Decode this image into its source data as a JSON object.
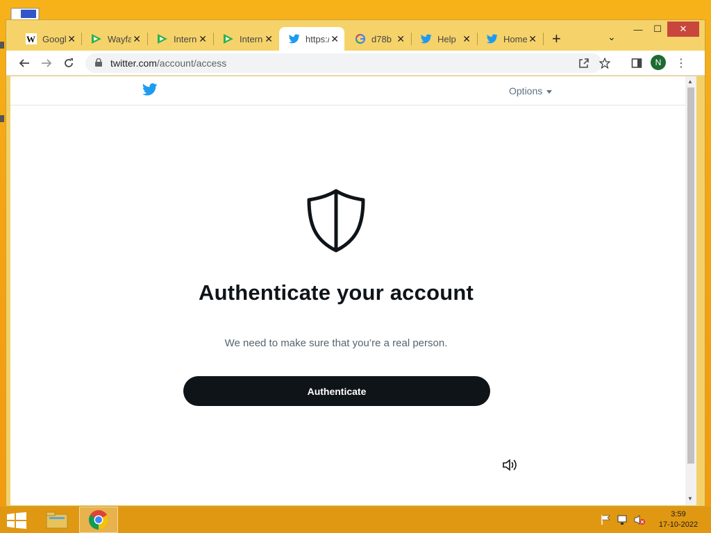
{
  "browser": {
    "tabs": [
      {
        "title": "Google",
        "favicon": "wikipedia-icon",
        "active": false
      },
      {
        "title": "Wayfair",
        "favicon": "green-play-icon",
        "active": false
      },
      {
        "title": "Internet",
        "favicon": "green-play-icon",
        "active": false
      },
      {
        "title": "Internet",
        "favicon": "green-play-icon",
        "active": false
      },
      {
        "title": "https://",
        "favicon": "twitter-bird-icon",
        "active": true
      },
      {
        "title": "d78b",
        "favicon": "google-g-icon",
        "active": false
      },
      {
        "title": "Help",
        "favicon": "twitter-bird-icon",
        "active": false
      },
      {
        "title": "Home",
        "favicon": "twitter-bird-icon",
        "active": false
      }
    ],
    "close_glyph": "✕",
    "new_tab_glyph": "+",
    "tab_list_glyph": "⌄",
    "window_controls": {
      "minimize": "—",
      "maximize": "☐",
      "close": "✕"
    },
    "address": {
      "domain": "twitter.com",
      "path": "/account/access"
    },
    "profile_initial": "N"
  },
  "page": {
    "options_label": "Options",
    "heading": "Authenticate your account",
    "subtext": "We need to make sure that you’re a real person.",
    "button_label": "Authenticate"
  },
  "taskbar": {
    "time": "3:59",
    "date": "17-10-2022"
  },
  "colors": {
    "twitter_blue": "#1d9bf0",
    "button_dark": "#0f1419",
    "desktop_orange": "#f5a313"
  }
}
